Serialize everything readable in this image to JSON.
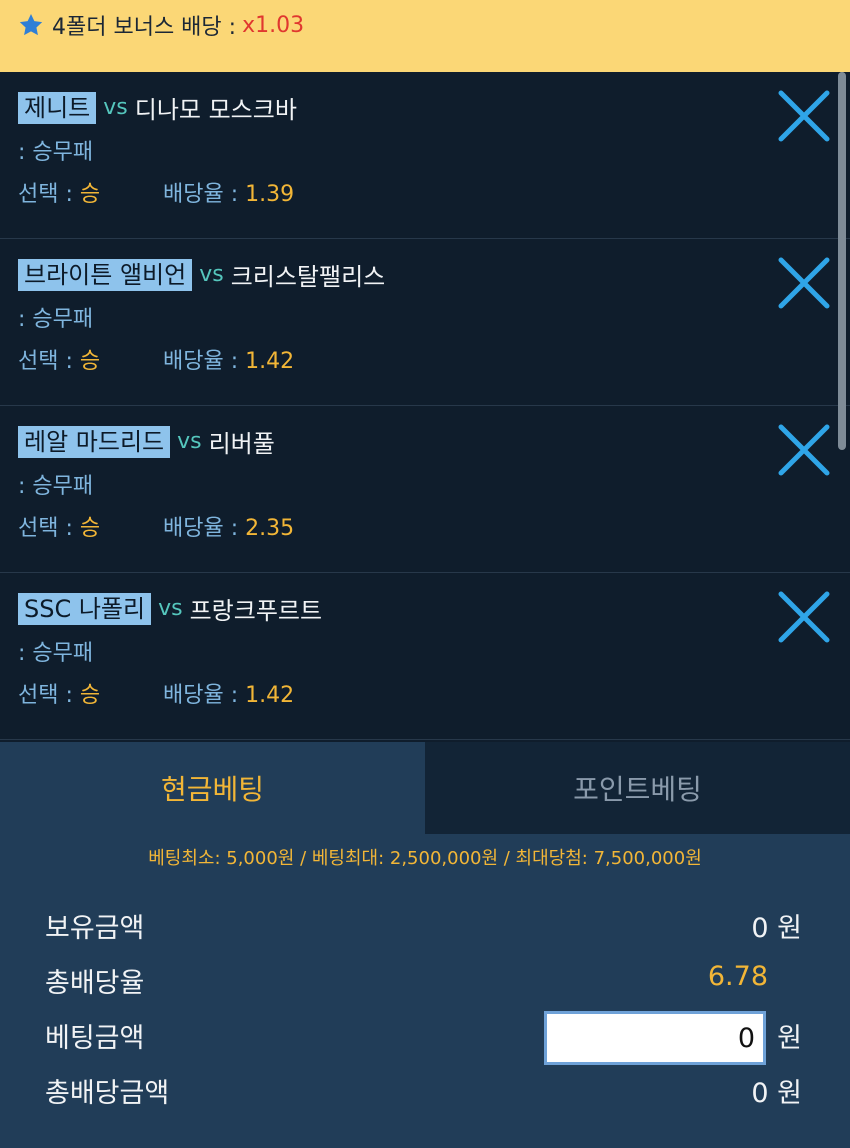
{
  "bonus": {
    "label": "4폴더 보너스 배당 :",
    "multiplier": "x1.03",
    "icon": "star-icon"
  },
  "bets": [
    {
      "home": "제니트",
      "vs": "vs",
      "away": "디나모 모스크바",
      "market": ": 승무패",
      "select_label": "선택 : ",
      "pick": "승",
      "odds_label": "배당율 : ",
      "odds": "1.39"
    },
    {
      "home": "브라이튼 앨비언",
      "vs": "vs",
      "away": "크리스탈팰리스",
      "market": ": 승무패",
      "select_label": "선택 : ",
      "pick": "승",
      "odds_label": "배당율 : ",
      "odds": "1.42"
    },
    {
      "home": "레알 마드리드",
      "vs": "vs",
      "away": "리버풀",
      "market": ": 승무패",
      "select_label": "선택 : ",
      "pick": "승",
      "odds_label": "배당율 : ",
      "odds": "2.35"
    },
    {
      "home": "SSC 나폴리",
      "vs": "vs",
      "away": "프랑크푸르트",
      "market": ": 승무패",
      "select_label": "선택 : ",
      "pick": "승",
      "odds_label": "배당율 : ",
      "odds": "1.42"
    }
  ],
  "tabs": {
    "cash": "현금베팅",
    "point": "포인트베팅"
  },
  "limits": "베팅최소: 5,000원 / 베팅최대: 2,500,000원 / 최대당첨: 7,500,000원",
  "summary": {
    "balance_label": "보유금액",
    "balance_value": "0 원",
    "total_odds_label": "총배당율",
    "total_odds_value": "6.78",
    "stake_label": "베팅금액",
    "stake_value": "0",
    "stake_unit": "원",
    "payout_label": "총배당금액",
    "payout_value": "0 원"
  },
  "colors": {
    "bonus_bg": "#fbd776",
    "accent_yellow": "#f2b637",
    "team_highlight": "#8ec3ec",
    "close_icon": "#2fa5e8",
    "panel_bg": "#213d58"
  }
}
